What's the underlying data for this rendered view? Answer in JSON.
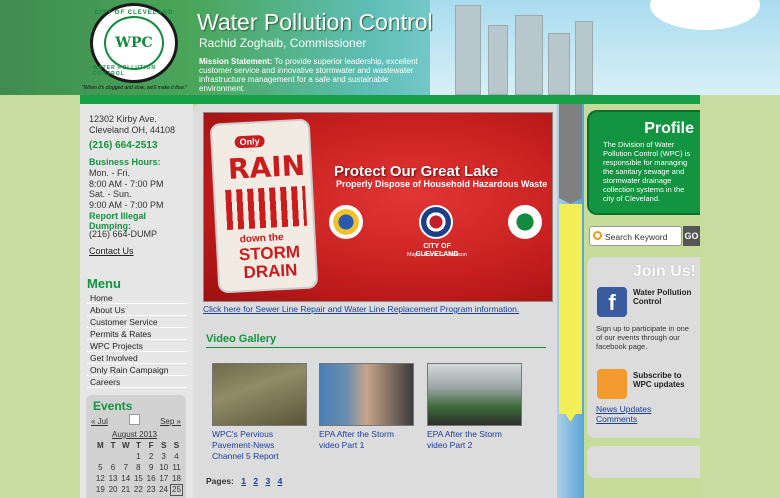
{
  "header": {
    "logo_text": "WPC",
    "logo_ring_top": "CITY OF CLEVELAND",
    "logo_ring_bottom": "WATER POLLUTION CONTROL",
    "tagline": "\"When it's clogged and slow, we'll make it flow.\"",
    "title": "Water Pollution Control",
    "subtitle": "Rachid Zoghaib, Commissioner",
    "mission_label": "Mission Statement:",
    "mission_text": " To provide superior leadership, excellent customer service and innovative stormwater and wastewater infrastructure management for a safe and sustainable environment."
  },
  "sidebar": {
    "address_line1": "12302 Kirby Ave.",
    "address_line2": "Cleveland OH, 44108",
    "phone": "(216) 664-2513",
    "hours_title": "Business Hours:",
    "hours": [
      "Mon. - Fri.",
      "8:00 AM - 7:00 PM",
      "Sat. - Sun.",
      "9:00 AM - 7:00 PM"
    ],
    "report_title_1": "Report Illegal",
    "report_title_2": "Dumping:",
    "report_number": "(216) 664-DUMP",
    "contact": "Contact Us",
    "menu_title": "Menu",
    "menu": [
      "Home",
      "About Us",
      "Customer Service",
      "Permits & Rates",
      "WPC Projects",
      "Get Involved",
      "Only Rain Campaign",
      "Careers"
    ],
    "events_title": "Events",
    "prev": "« Jul",
    "next": "Sep »",
    "month": "August 2013",
    "weekdays": [
      "M",
      "T",
      "W",
      "T",
      "F",
      "S",
      "S"
    ],
    "weeks": [
      [
        "",
        "",
        "",
        "1",
        "2",
        "3",
        "4"
      ],
      [
        "5",
        "6",
        "7",
        "8",
        "9",
        "10",
        "11"
      ],
      [
        "12",
        "13",
        "14",
        "15",
        "16",
        "17",
        "18"
      ],
      [
        "19",
        "20",
        "21",
        "22",
        "23",
        "24",
        "25"
      ]
    ],
    "today": "25"
  },
  "banner": {
    "only": "Only",
    "rain": "RAIN",
    "down": "down the",
    "storm": "STORM",
    "drain": "DRAIN",
    "headline": "Protect Our Great Lake",
    "subhead": "Properly Dispose of Household Hazardous Waste",
    "city": "CITY OF CLEVELAND",
    "mayor": "Mayor Frank G. Jackson",
    "link": "Click here for Sewer Line Repair and Water Line Replacement Program information."
  },
  "gallery": {
    "title": "Video Gallery",
    "videos": [
      {
        "caption": "WPC's Pervious Pavement-News Channel 5 Report"
      },
      {
        "caption": "EPA After the Storm video Part 1"
      },
      {
        "caption": "EPA After the Storm video Part 2"
      }
    ],
    "pages_label": "Pages:",
    "pages": [
      "1",
      "2",
      "3",
      "4"
    ]
  },
  "right": {
    "profile_title": "Profile",
    "profile_text": "The Division of Water Pollution Control (WPC) is responsible for managing the sanitary sewage and stormwater drainage collection systems in the city of Cleveland.",
    "search_placeholder": "Search Keyword",
    "go": "GO",
    "join_title": "Join Us!",
    "fb_label": "Water Pollution Control",
    "fb_text": "Sign up to participate in one of our events through our facebook page.",
    "rss_label": "Subscribe to WPC updates",
    "news_updates": "News Updates",
    "comments": "Comments"
  }
}
